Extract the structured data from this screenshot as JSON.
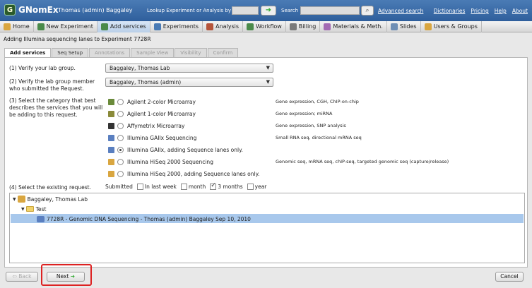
{
  "header": {
    "app_name": "GNomEx",
    "user": "Thomas (admin) Baggaley",
    "lookup_label": "Lookup Experiment or Analysis by #",
    "lookup_value": "",
    "search_label": "Search",
    "search_value": "",
    "advanced_search": "Advanced search",
    "links": [
      "Dictionaries",
      "Pricing",
      "Help",
      "About"
    ]
  },
  "menu": [
    {
      "label": "Home",
      "icon": "home-icon",
      "color": "#d9a640"
    },
    {
      "label": "New Experiment",
      "icon": "flask-icon",
      "color": "#4a8a4a"
    },
    {
      "label": "Add services",
      "icon": "flask-plus-icon",
      "color": "#4a8a4a"
    },
    {
      "label": "Experiments",
      "icon": "flask-icon",
      "color": "#4a7bb5"
    },
    {
      "label": "Analysis",
      "icon": "chart-icon",
      "color": "#b5543a"
    },
    {
      "label": "Workflow",
      "icon": "workflow-icon",
      "color": "#4a8a4a"
    },
    {
      "label": "Billing",
      "icon": "billing-icon",
      "color": "#7a7a7a"
    },
    {
      "label": "Materials & Meth.",
      "icon": "materials-icon",
      "color": "#a36bb3"
    },
    {
      "label": "Slides",
      "icon": "slides-icon",
      "color": "#6f8fb5"
    },
    {
      "label": "Users & Groups",
      "icon": "users-icon",
      "color": "#d9a640"
    }
  ],
  "page_title": "Adding Illumina sequencing lanes to Experiment 7728R",
  "tabs": [
    "Add services",
    "Seq Setup",
    "Annotations",
    "Sample View",
    "Visibility",
    "Confirm"
  ],
  "steps": {
    "lab_label": "(1) Verify your lab group.",
    "lab_value": "Baggaley, Thomas Lab",
    "member_label": "(2) Verify the lab group member who submitted the Request.",
    "member_value": "Baggaley, Thomas (admin)",
    "category_label": "(3) Select the category that best describes the services that you will be adding to this request.",
    "request_label": "(4) Select the existing request."
  },
  "categories": [
    {
      "label": "Agilent 2-color Microarray",
      "desc": "Gene expression, CGH, ChIP-on-chip",
      "selected": false,
      "icon": "agilent-2color-icon",
      "color": "#6a8a3a"
    },
    {
      "label": "Agilent 1-color Microarray",
      "desc": "Gene expression; miRNA",
      "selected": false,
      "icon": "agilent-1color-icon",
      "color": "#8a8a3a"
    },
    {
      "label": "Affymetrix Microarray",
      "desc": "Gene expression, SNP analysis",
      "selected": false,
      "icon": "affymetrix-icon",
      "color": "#333333"
    },
    {
      "label": "Illumina GAIIx Sequencing",
      "desc": "Small RNA seq, directional mRNA seq",
      "selected": false,
      "icon": "illumina-icon",
      "color": "#5a7fc0"
    },
    {
      "label": "Illumina GAIIx, adding Sequence lanes only.",
      "desc": "",
      "selected": true,
      "icon": "illumina-icon",
      "color": "#5a7fc0"
    },
    {
      "label": "Illumina HiSeq 2000 Sequencing",
      "desc": "Genomic seq, mRNA seq, chIP-seq, targeted genomic seq (capture/release)",
      "selected": false,
      "icon": "hiseq-icon",
      "color": "#d9a640"
    },
    {
      "label": "Illumina HiSeq 2000, adding Sequence lanes only.",
      "desc": "",
      "selected": false,
      "icon": "hiseq-icon",
      "color": "#d9a640"
    }
  ],
  "filter": {
    "label": "Submitted",
    "options": [
      {
        "label": "In last week",
        "checked": false
      },
      {
        "label": "month",
        "checked": false
      },
      {
        "label": "3 months",
        "checked": true
      },
      {
        "label": "year",
        "checked": false
      }
    ]
  },
  "tree": {
    "root": "Baggaley, Thomas Lab",
    "folder": "Test",
    "item": "7728R - Genomic DNA Sequencing - Thomas (admin) Baggaley Sep 10, 2010"
  },
  "buttons": {
    "back": "Back",
    "next": "Next",
    "cancel": "Cancel"
  }
}
